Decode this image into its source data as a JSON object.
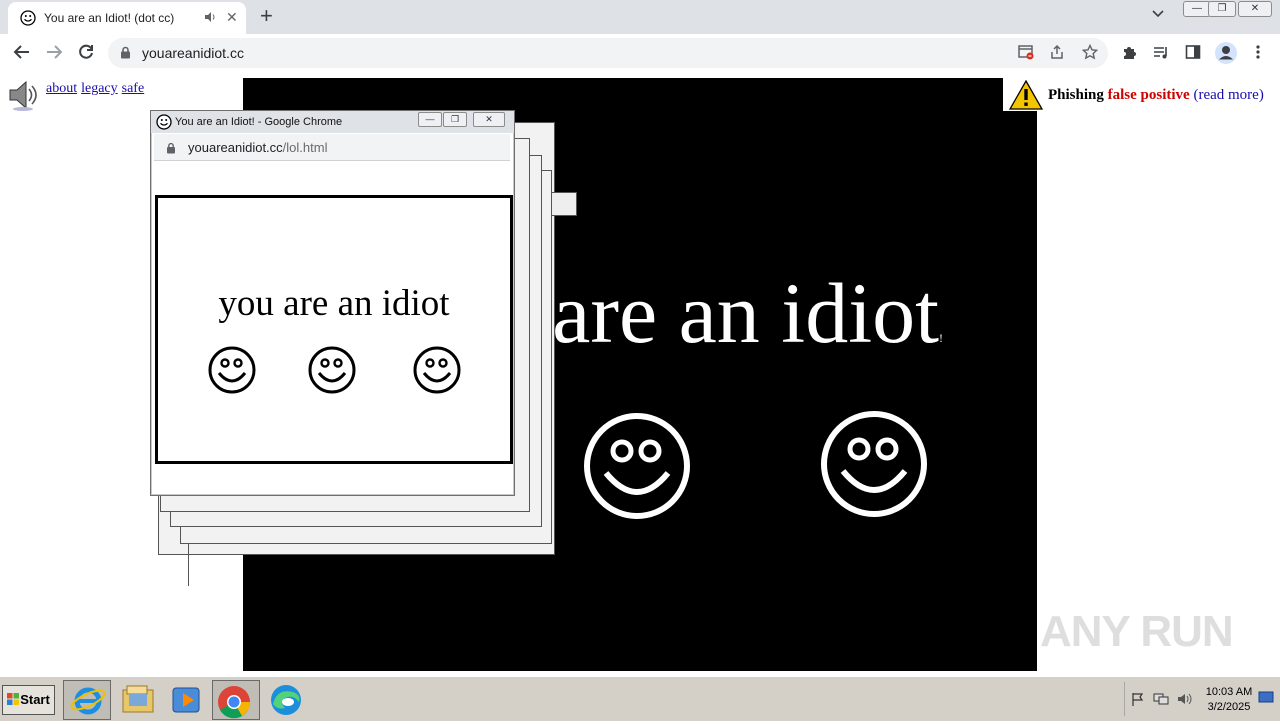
{
  "browser": {
    "tab_title": "You are an Idiot! (dot cc)",
    "tab_close": "✕",
    "new_tab": "+",
    "address_url": "youareanidiot.cc",
    "min_label": "—",
    "restore_label": "❐",
    "close_label": "✕"
  },
  "page": {
    "links": [
      "about",
      "legacy",
      "safe"
    ],
    "big_text": "are an idiot",
    "big_text_suffix": "!",
    "warning": {
      "label": "Phishing",
      "highlight": "false positive",
      "link": "(read more)"
    },
    "watermark": "ANY RUN"
  },
  "popup": {
    "window_title": "You are an Idiot! - Google Chrome",
    "url_domain": "youareanidiot.cc",
    "url_path": "/lol.html",
    "text": "you are an idiot",
    "min_label": "—",
    "restore_label": "❐",
    "close_label": "✕"
  },
  "taskbar": {
    "start_label": "Start",
    "time": "10:03 AM",
    "date": "3/2/2025"
  },
  "colors": {
    "warning_red": "#cc0000",
    "link_blue": "#1a0dab",
    "stage_black": "#000000"
  },
  "icons": [
    "smiley-favicon-icon",
    "audio-icon",
    "back-arrow-icon",
    "forward-arrow-icon",
    "reload-icon",
    "lock-icon",
    "star-icon",
    "extensions-icon",
    "profile-icon",
    "menu-icon",
    "speaker-icon",
    "warning-icon",
    "ie-icon",
    "explorer-icon",
    "media-icon",
    "chrome-icon",
    "edge-icon"
  ]
}
